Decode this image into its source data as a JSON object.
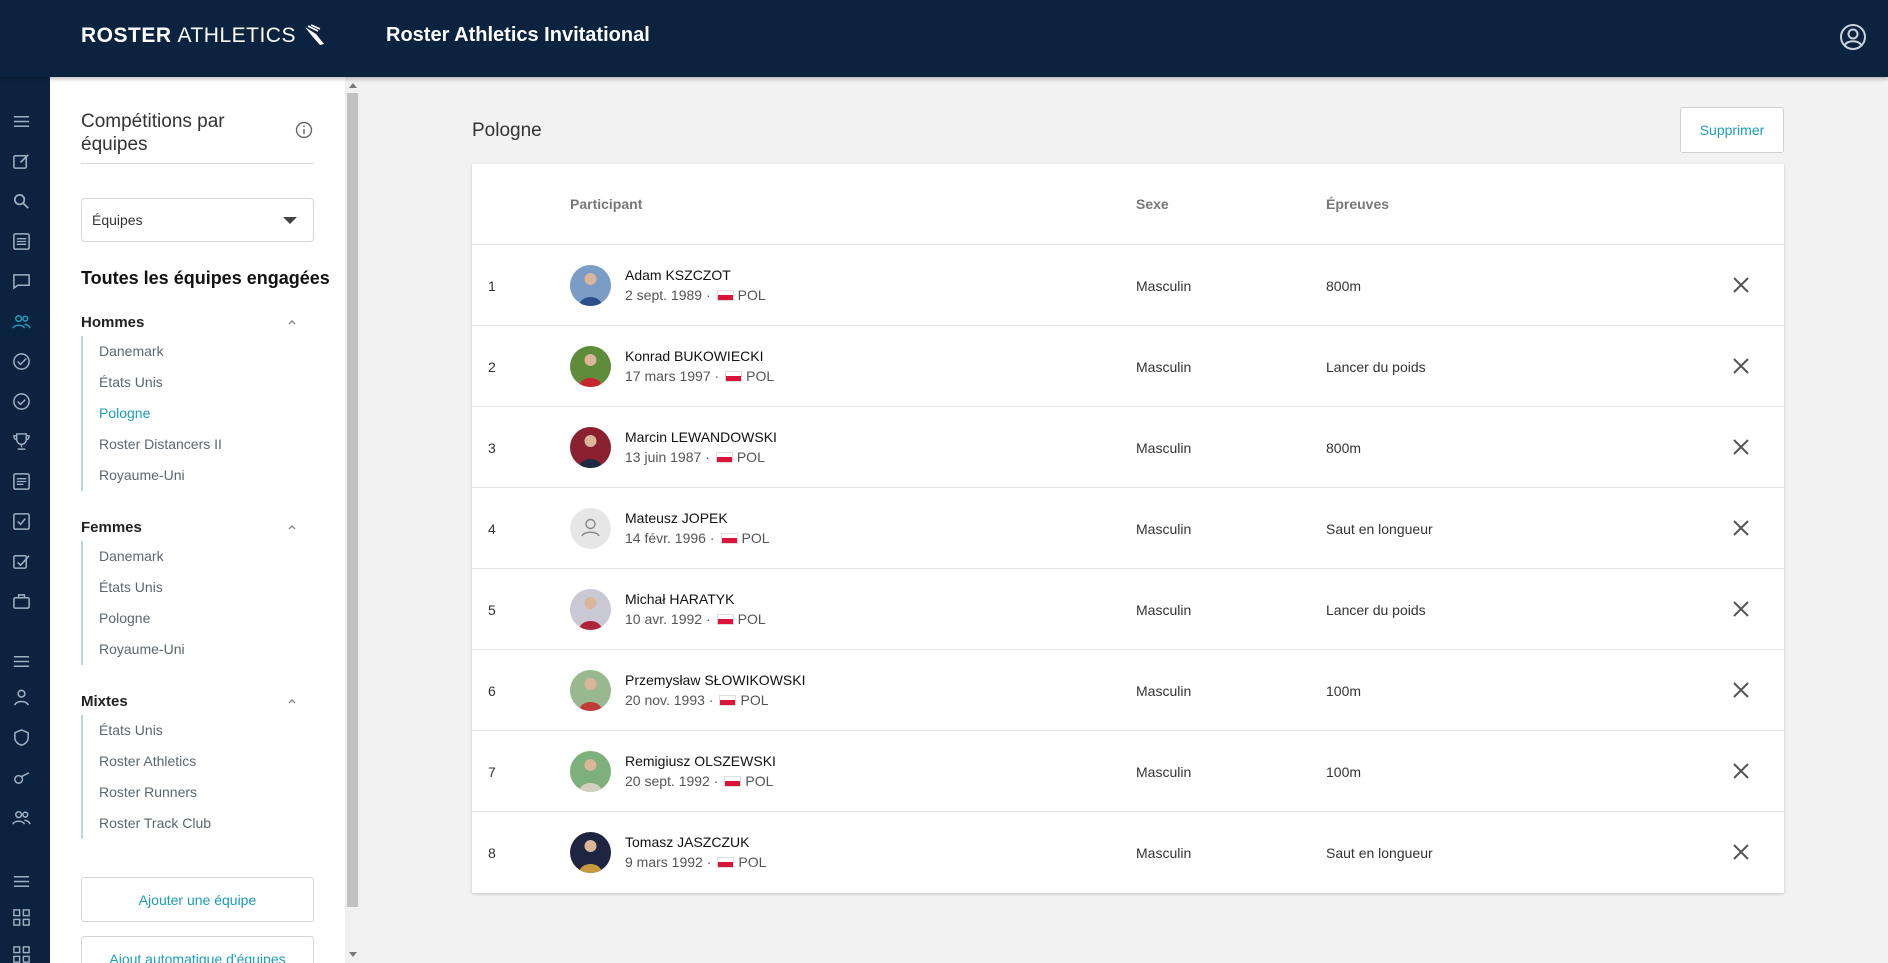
{
  "header": {
    "brand_bold": "ROSTER",
    "brand_light": "ATHLETICS",
    "title": "Roster Athletics Invitational"
  },
  "colors": {
    "navy": "#0c2340",
    "accent": "#1b9cb8",
    "flag_red": "#dc143c"
  },
  "rail": {
    "icons": [
      "menu-icon",
      "edit-icon",
      "search-icon",
      "list-icon",
      "chat-icon",
      "teams-icon",
      "check-circle-icon",
      "check-circle-outline-icon",
      "trophy-icon",
      "results-list-icon",
      "checkbox-icon",
      "signature-check-icon",
      "briefcase-icon",
      "menu-icon",
      "person-icon",
      "shield-icon",
      "whistle-icon",
      "group-icon",
      "menu-icon",
      "grid-icon",
      "grid-icon"
    ]
  },
  "sidebar": {
    "title": "Compétitions par équipes",
    "select_value": "Équipes",
    "all_teams_heading": "Toutes les équipes engagées",
    "groups": [
      {
        "name": "Hommes",
        "items": [
          "Danemark",
          "États Unis",
          "Pologne",
          "Roster Distancers II",
          "Royaume-Uni"
        ],
        "active_index": 2
      },
      {
        "name": "Femmes",
        "items": [
          "Danemark",
          "États Unis",
          "Pologne",
          "Royaume-Uni"
        ]
      },
      {
        "name": "Mixtes",
        "items": [
          "États Unis",
          "Roster Athletics",
          "Roster Runners",
          "Roster Track Club"
        ]
      }
    ],
    "add_team_label": "Ajouter une équipe",
    "auto_add_label": "Ajout automatique d'équipes"
  },
  "main": {
    "heading": "Pologne",
    "delete_label": "Supprimer",
    "columns": {
      "participant": "Participant",
      "sex": "Sexe",
      "events": "Épreuves"
    },
    "rows": [
      {
        "num": "1",
        "name": "Adam KSZCZOT",
        "dob": "2 sept. 1989 ·",
        "country": "POL",
        "sex": "Masculin",
        "event": "800m",
        "avatar": "photo"
      },
      {
        "num": "2",
        "name": "Konrad BUKOWIECKI",
        "dob": "17 mars 1997 ·",
        "country": "POL",
        "sex": "Masculin",
        "event": "Lancer du poids",
        "avatar": "photo"
      },
      {
        "num": "3",
        "name": "Marcin LEWANDOWSKI",
        "dob": "13 juin 1987 ·",
        "country": "POL",
        "sex": "Masculin",
        "event": "800m",
        "avatar": "photo"
      },
      {
        "num": "4",
        "name": "Mateusz JOPEK",
        "dob": "14 févr. 1996 ·",
        "country": "POL",
        "sex": "Masculin",
        "event": "Saut en longueur",
        "avatar": "placeholder"
      },
      {
        "num": "5",
        "name": "Michał HARATYK",
        "dob": "10 avr. 1992 ·",
        "country": "POL",
        "sex": "Masculin",
        "event": "Lancer du poids",
        "avatar": "photo"
      },
      {
        "num": "6",
        "name": "Przemysław SŁOWIKOWSKI",
        "dob": "20 nov. 1993 ·",
        "country": "POL",
        "sex": "Masculin",
        "event": "100m",
        "avatar": "photo"
      },
      {
        "num": "7",
        "name": "Remigiusz OLSZEWSKI",
        "dob": "20 sept. 1992 ·",
        "country": "POL",
        "sex": "Masculin",
        "event": "100m",
        "avatar": "photo"
      },
      {
        "num": "8",
        "name": "Tomasz JASZCZUK",
        "dob": "9 mars 1992 ·",
        "country": "POL",
        "sex": "Masculin",
        "event": "Saut en longueur",
        "avatar": "photo"
      }
    ]
  }
}
